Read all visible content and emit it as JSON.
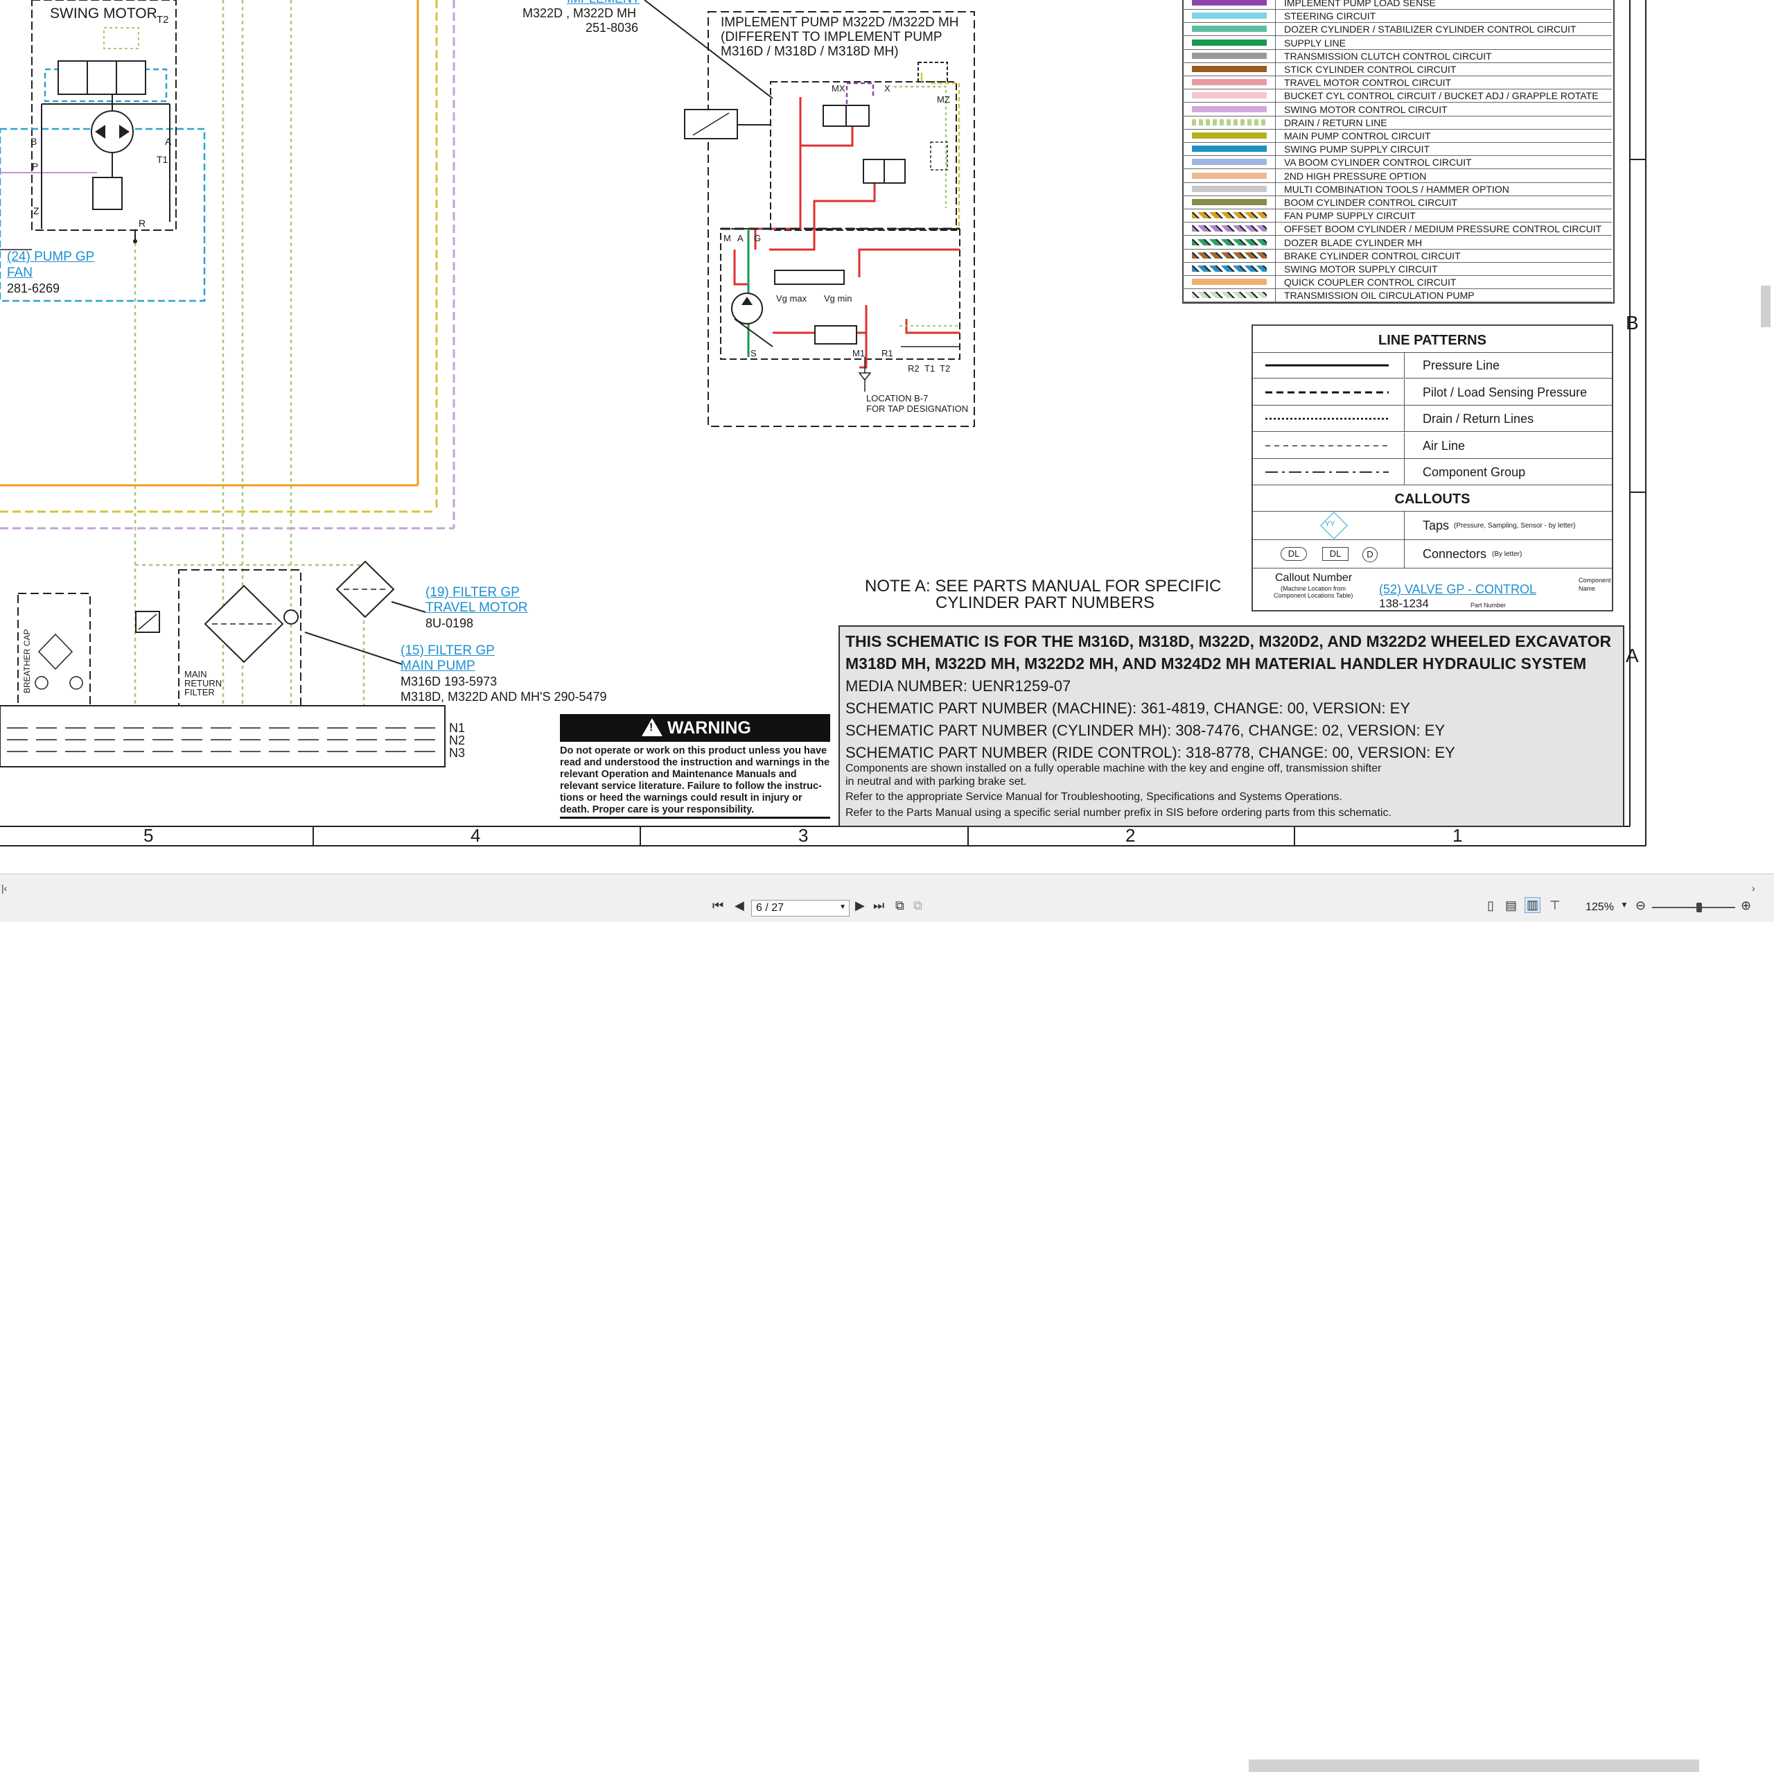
{
  "drawing": {
    "swing_motor_label": "SWING MOTOR",
    "t2_label": "T2",
    "port_labels": {
      "b": "B",
      "a": "A",
      "p": "P",
      "t1": "T1",
      "z": "Z",
      "r": "R",
      "x": "X",
      "mx": "MX",
      "mz": "MZ",
      "m": "M",
      "a2": "A",
      "g": "G",
      "s": "S",
      "m1": "M1",
      "r1": "R1",
      "r2": "R2",
      "t1b": "T1",
      "t2b": "T2",
      "vgmax": "Vg max",
      "vgmin": "Vg min"
    },
    "pump_gp_fan": {
      "callout": "(24) PUMP GP",
      "name": "FAN",
      "part": "281-6269"
    },
    "implement_callout": {
      "callout": "IMPLEMENT",
      "models": "M322D , M322D MH",
      "part": "251-8036"
    },
    "implement_pump_title": [
      "IMPLEMENT PUMP M322D /M322D MH",
      "(DIFFERENT TO IMPLEMENT PUMP",
      "M316D / M318D / M318D MH)"
    ],
    "location_note": [
      "LOCATION B-7",
      "FOR TAP DESIGNATION"
    ],
    "filter_travel": {
      "callout": "(19) FILTER GP",
      "name": "TRAVEL MOTOR",
      "part": "8U-0198"
    },
    "filter_main": {
      "callout": "(15) FILTER GP",
      "name": "MAIN PUMP",
      "part1": "M316D 193-5973",
      "part2": "M318D, M322D AND MH'S 290-5479"
    },
    "breather_cap": "BREATHER CAP",
    "main_return_filter": [
      "MAIN",
      "RETURN",
      "FILTER"
    ],
    "n_labels": [
      "N1",
      "N2",
      "N3"
    ],
    "note_a": [
      "NOTE A: SEE PARTS MANUAL FOR SPECIFIC",
      "CYLINDER PART NUMBERS"
    ],
    "border_letters": {
      "b": "B",
      "a": "A"
    },
    "columns": [
      "5",
      "4",
      "3",
      "2",
      "1"
    ]
  },
  "legend": {
    "items": [
      {
        "label": "IMPLEMENT PUMP LOAD SENSE",
        "color": "#8e44a8",
        "pattern": "solid"
      },
      {
        "label": "STEERING CIRCUIT",
        "color": "#7fd4e8",
        "pattern": "solid"
      },
      {
        "label": "DOZER CYLINDER / STABILIZER CYLINDER CONTROL CIRCUIT",
        "color": "#5cbfa0",
        "pattern": "solid"
      },
      {
        "label": "SUPPLY LINE",
        "color": "#1a9850",
        "pattern": "solid"
      },
      {
        "label": "TRANSMISSION CLUTCH CONTROL CIRCUIT",
        "color": "#999999",
        "pattern": "solid"
      },
      {
        "label": "STICK CYLINDER CONTROL CIRCUIT",
        "color": "#9a5a1a",
        "pattern": "solid"
      },
      {
        "label": "TRAVEL MOTOR CONTROL CIRCUIT",
        "color": "#e89aa0",
        "pattern": "solid"
      },
      {
        "label": "BUCKET CYL CONTROL CIRCUIT / BUCKET ADJ / GRAPPLE ROTATE",
        "color": "#f7c6cf",
        "pattern": "solid"
      },
      {
        "label": "SWING MOTOR CONTROL CIRCUIT",
        "color": "#d4a8dc",
        "pattern": "solid"
      },
      {
        "label": "DRAIN / RETURN LINE",
        "color": "#b8d08a",
        "pattern": "dotted"
      },
      {
        "label": "MAIN PUMP CONTROL CIRCUIT",
        "color": "#b6b21a",
        "pattern": "solid"
      },
      {
        "label": "SWING PUMP SUPPLY CIRCUIT",
        "color": "#1f8fc4",
        "pattern": "solid"
      },
      {
        "label": "VA BOOM CYLINDER CONTROL CIRCUIT",
        "color": "#9fb7de",
        "pattern": "solid"
      },
      {
        "label": "2ND HIGH PRESSURE OPTION",
        "color": "#f0b890",
        "pattern": "solid"
      },
      {
        "label": "MULTI COMBINATION TOOLS / HAMMER OPTION",
        "color": "#c8c8c8",
        "pattern": "solid"
      },
      {
        "label": "BOOM CYLINDER CONTROL CIRCUIT",
        "color": "#8a8a4a",
        "pattern": "solid"
      },
      {
        "label": "FAN PUMP SUPPLY CIRCUIT",
        "color": "#d4a020",
        "pattern": "stripe"
      },
      {
        "label": "OFFSET BOOM CYLINDER / MEDIUM PRESSURE CONTROL CIRCUIT",
        "color": "#b088d0",
        "pattern": "stripe"
      },
      {
        "label": "DOZER BLADE CYLINDER MH",
        "color": "#2ea06a",
        "pattern": "stripe"
      },
      {
        "label": "BRAKE CYLINDER CONTROL CIRCUIT",
        "color": "#a06a30",
        "pattern": "stripe"
      },
      {
        "label": "SWING MOTOR SUPPLY CIRCUIT",
        "color": "#2a8fc8",
        "pattern": "stripe"
      },
      {
        "label": "QUICK COUPLER CONTROL CIRCUIT",
        "color": "#f0b070",
        "pattern": "solid"
      },
      {
        "label": "TRANSMISSION OIL CIRCULATION PUMP",
        "color": "#c8e0c0",
        "pattern": "stripe"
      }
    ]
  },
  "line_patterns": {
    "title": "LINE PATTERNS",
    "items": [
      {
        "label": "Pressure Line",
        "style": "solid"
      },
      {
        "label": "Pilot / Load Sensing Pressure",
        "style": "dashed"
      },
      {
        "label": "Drain / Return Lines",
        "style": "dotted"
      },
      {
        "label": "Air Line",
        "style": "thin-dashed"
      },
      {
        "label": "Component Group",
        "style": "dash-dot"
      }
    ],
    "callouts_title": "CALLOUTS",
    "taps_label": "Taps",
    "taps_note": "(Pressure, Sampling, Sensor - by letter)",
    "taps_symbol": "YY",
    "connectors_label": "Connectors",
    "connectors_note": "(By letter)",
    "connector_symbols": [
      "DL",
      "DL",
      "D"
    ],
    "callout_number_label": "Callout Number",
    "callout_number_note": [
      "(Machine Location from",
      "Component Locations Table)"
    ],
    "callout_example": "(52) VALVE GP - CONTROL",
    "component_name_note": [
      "Component",
      "Name"
    ],
    "part_example": "138-1234",
    "part_number_note": "Part Number"
  },
  "title_block": {
    "line1": "THIS SCHEMATIC IS FOR THE M316D, M318D, M322D, M320D2, AND M322D2 WHEELED EXCAVATOR",
    "line2": "M318D MH, M322D MH, M322D2 MH, AND M324D2 MH MATERIAL HANDLER HYDRAULIC SYSTEM",
    "media": "MEDIA NUMBER: UENR1259-07",
    "part_machine": "SCHEMATIC PART NUMBER (MACHINE): 361-4819, CHANGE: 00, VERSION: EY",
    "part_cylinder": "SCHEMATIC PART NUMBER (CYLINDER MH): 308-7476, CHANGE: 02, VERSION: EY",
    "part_ride": "SCHEMATIC PART NUMBER (RIDE CONTROL): 318-8778, CHANGE: 00, VERSION: EY",
    "note1": "Components are shown installed on a fully operable machine with the key and engine off, transmission shifter",
    "note2": "in neutral and with parking brake set.",
    "note3": "Refer to the appropriate Service Manual for Troubleshooting, Specifications and Systems Operations.",
    "note4": "Refer to the Parts Manual using a specific serial number prefix in SIS before ordering parts from this schematic."
  },
  "warning": {
    "title": "WARNING",
    "lines": [
      "Do not operate or work on this product unless you have",
      "read and understood the instruction and warnings in the",
      "relevant Operation and Maintenance Manuals and",
      "relevant service literature. Failure to follow the instruc-",
      "tions or heed the warnings could result in injury or",
      "death. Proper care is your responsibility."
    ]
  },
  "status_bar": {
    "page_value": "6 / 27",
    "zoom": "125%"
  }
}
